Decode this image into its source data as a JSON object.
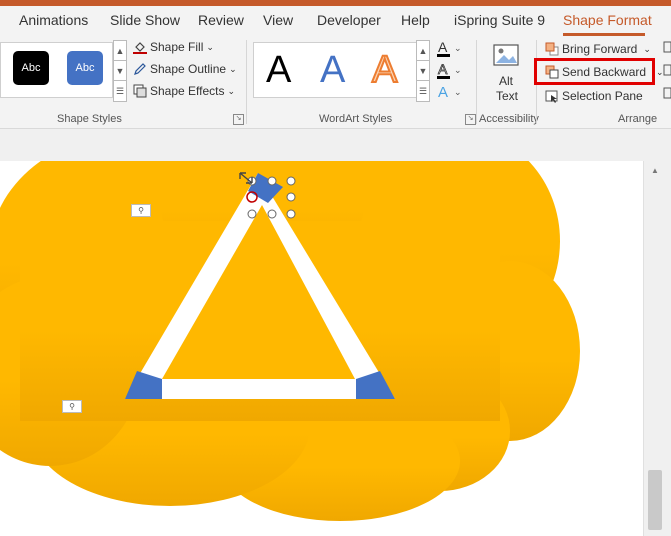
{
  "tabs": [
    "Animations",
    "Slide Show",
    "Review",
    "View",
    "Developer",
    "Help",
    "iSpring Suite 9",
    "Shape Format"
  ],
  "active_tab": "Shape Format",
  "shape_styles": {
    "swatches": [
      {
        "label": "Abc",
        "color": "#000000"
      },
      {
        "label": "Abc",
        "color": "#4472c4"
      }
    ],
    "commands": {
      "fill": "Shape Fill",
      "outline": "Shape Outline",
      "effects": "Shape Effects"
    },
    "group_label": "Shape Styles"
  },
  "wordart": {
    "samples": [
      {
        "label": "A",
        "style": "black"
      },
      {
        "label": "A",
        "style": "blue"
      },
      {
        "label": "A",
        "style": "orange-outline"
      }
    ],
    "group_label": "WordArt Styles"
  },
  "accessibility": {
    "alt_text_line1": "Alt",
    "alt_text_line2": "Text",
    "group_label": "Accessibility"
  },
  "arrange": {
    "bring_forward": "Bring Forward",
    "send_backward": "Send Backward",
    "selection_pane": "Selection Pane",
    "group_label": "Arrange"
  },
  "colors": {
    "accent": "#c55a2a",
    "cloud": "#ffb800",
    "triangle_fill": "#ffffff",
    "triangle_corners": "#4472c4",
    "highlight_box": "#e00000"
  }
}
